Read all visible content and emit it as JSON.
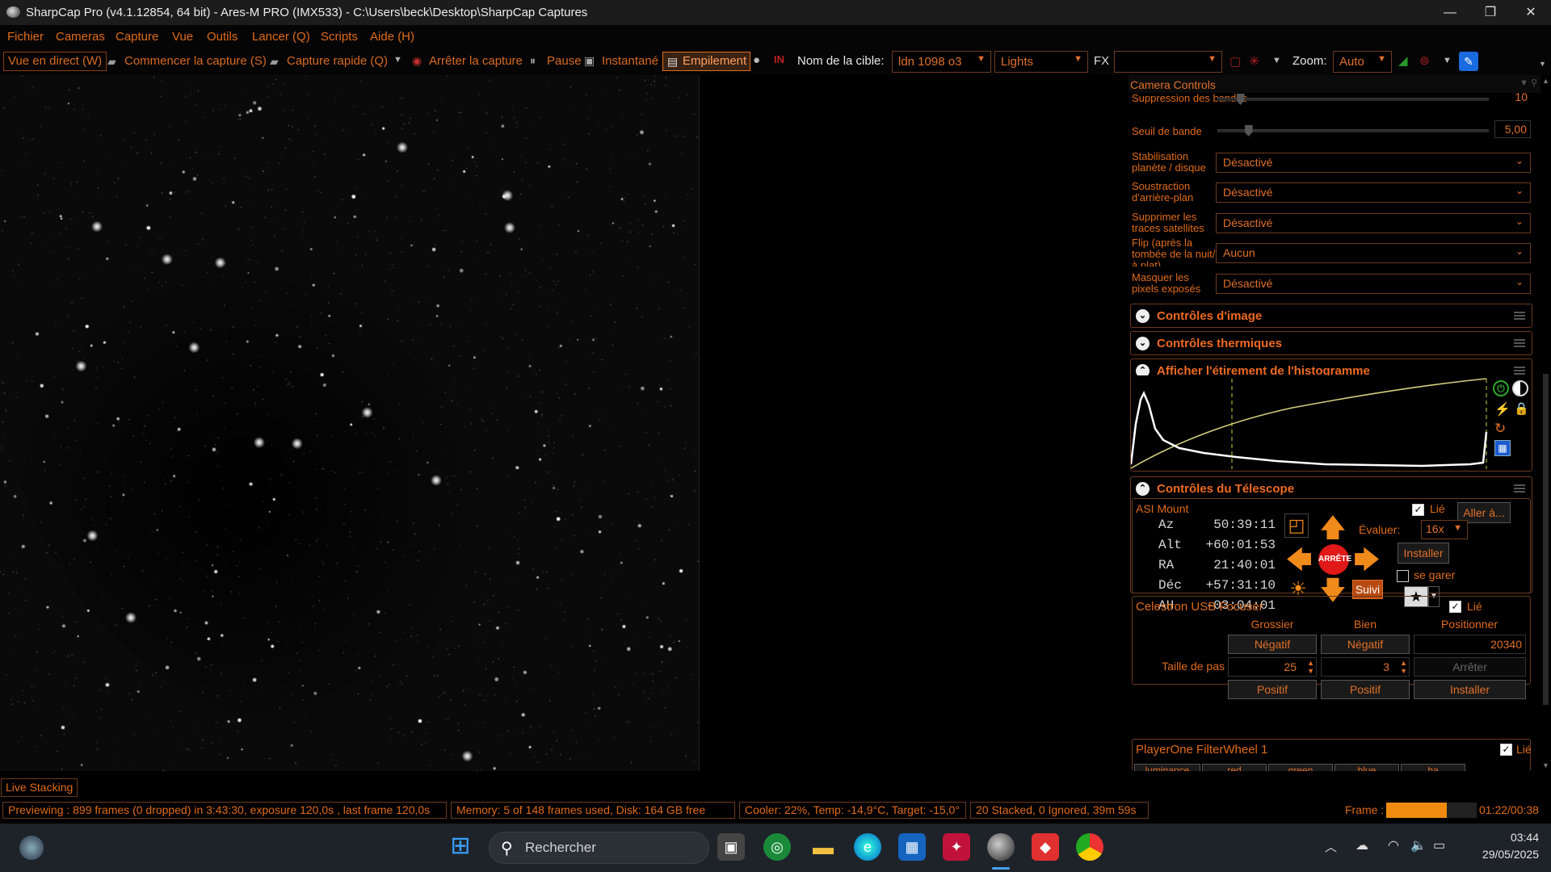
{
  "window": {
    "title": "SharpCap Pro (v4.1.12854, 64 bit) - Ares-M PRO (IMX533) - C:\\Users\\beck\\Desktop\\SharpCap Captures",
    "minimize": "—",
    "restore": "❐",
    "close": "✕"
  },
  "menu": [
    "Fichier",
    "Cameras",
    "Capture",
    "Vue",
    "Outils",
    "Lancer (Q)",
    "Scripts",
    "Aide (H)"
  ],
  "toolbar": {
    "live_view": "Vue en direct (W)",
    "start_capture": "Commencer la capture (S)",
    "quick_capture": "Capture rapide (Q)",
    "stop_capture": "Arrêter la capture",
    "pause": "Pause",
    "snapshot": "Instantané",
    "stacking": "Empilement",
    "target_label": "Nom de la cible:",
    "target_value": "ldn 1098 o3",
    "frame_type": "Lights",
    "fx_label": "FX",
    "fx_value": "",
    "zoom_label": "Zoom:",
    "zoom_value": "Auto"
  },
  "panel": {
    "title": "Camera Controls",
    "rows": [
      {
        "label": "Suppression des bandes",
        "value": "10",
        "slider": 0.07
      },
      {
        "label": "Seuil de bande",
        "value": "5,00",
        "slider": 0.1
      }
    ],
    "dropdowns": [
      {
        "label": "Stabilisation planète / disque",
        "value": "Désactivé"
      },
      {
        "label": "Soustraction d'arrière-plan",
        "value": "Désactivé"
      },
      {
        "label": "Supprimer les traces satellites",
        "value": "Désactivé"
      },
      {
        "label": "Flip (après la tombée de la nuit/à plat)",
        "value": "Aucun"
      },
      {
        "label": "Masquer les pixels exposés",
        "value": "Désactivé"
      }
    ],
    "sections": {
      "image": "Contrôles d'image",
      "thermal": "Contrôles thermiques",
      "histogram": "Afficher l'étirement de l'histogramme",
      "telescope": "Contrôles du Télescope"
    },
    "mount": {
      "name": "ASI Mount",
      "linked_label": "Lié",
      "goto": "Aller à...",
      "rate_label": "Évaluer:",
      "rate_value": "16x",
      "install": "Installer",
      "park": "se garer",
      "stop": "ARRÊTE",
      "tracking": "Suivi",
      "coords": [
        {
          "k": "Az",
          "v": "50:39:11"
        },
        {
          "k": "Alt",
          "v": "+60:01:53"
        },
        {
          "k": "RA",
          "v": "21:40:01"
        },
        {
          "k": "Déc",
          "v": "+57:31:10"
        },
        {
          "k": "AH",
          "v": "-03:04:01"
        }
      ]
    },
    "focuser": {
      "name": "Celestron USB Focuser",
      "linked_label": "Lié",
      "col_coarse": "Grossier",
      "col_fine": "Bien",
      "col_position": "Positionner",
      "negative": "Négatif",
      "positive": "Positif",
      "step_label": "Taille de pas",
      "step_coarse": "25",
      "step_fine": "3",
      "position": "20340",
      "stop": "Arrêter",
      "install": "Installer"
    },
    "filterwheel": {
      "name": "PlayerOne FilterWheel 1",
      "linked_label": "Lié",
      "filters": [
        "luminance",
        "red",
        "green",
        "blue",
        "ha"
      ]
    }
  },
  "live_stacking_tab": "Live Stacking",
  "status": {
    "preview": "Previewing : 899 frames (0 dropped) in 3:43:30, exposure 120,0s , last frame 120,0s",
    "memory": "Memory: 5 of 148 frames used, Disk: 164 GB free",
    "cooler": "Cooler: 22%, Temp: -14,9°C, Target: -15,0°",
    "stacked": "20 Stacked, 0 Ignored, 39m 59s",
    "frame_label": "Frame :",
    "frame_progress": 0.67,
    "frame_time": "01:22/00:38"
  },
  "taskbar": {
    "search_placeholder": "Rechercher",
    "time": "03:44",
    "date": "29/05/2025"
  },
  "colors": {
    "accent": "#e06b1b",
    "tele_button": "#f08a1a",
    "stop_red": "#e01818"
  }
}
